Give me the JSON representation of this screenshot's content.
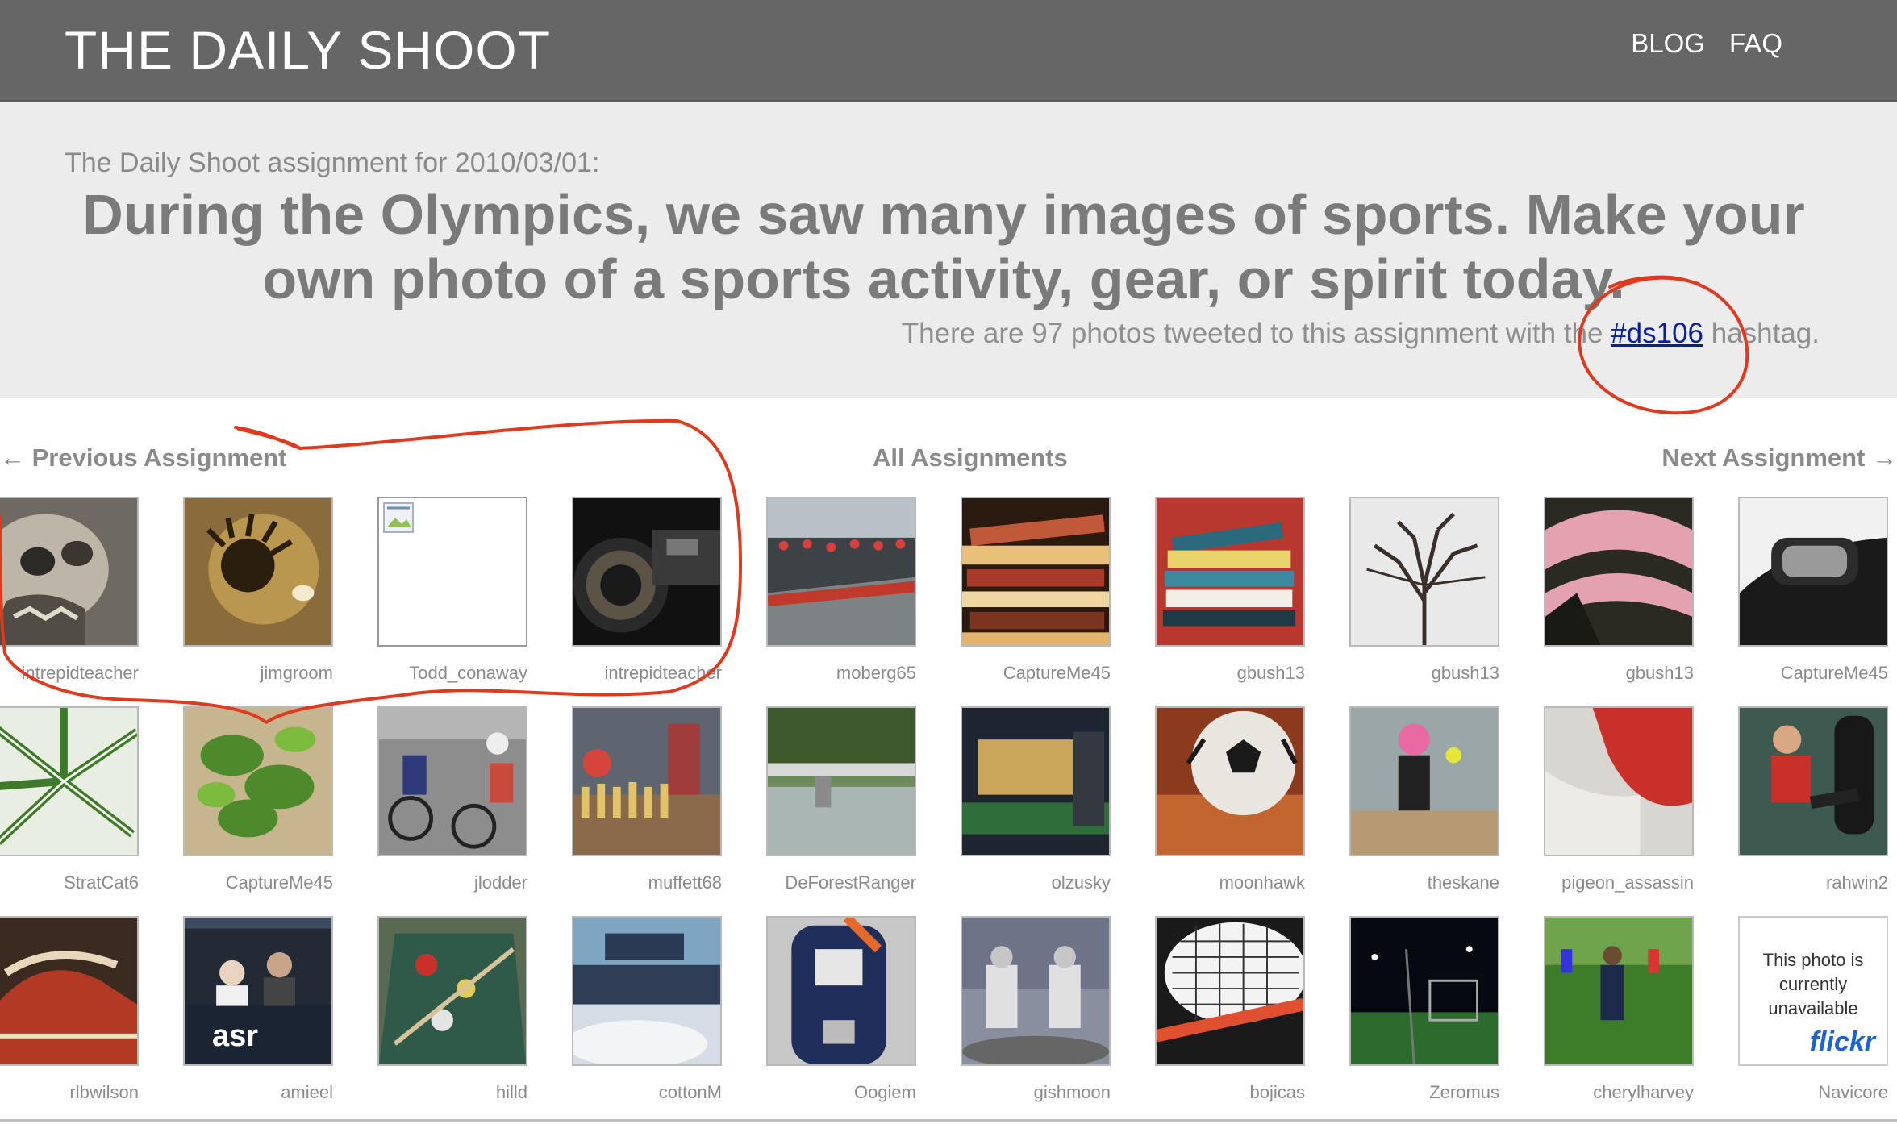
{
  "header": {
    "site_title": "THE DAILY SHOOT",
    "nav": [
      {
        "label": "BLOG"
      },
      {
        "label": "FAQ"
      }
    ]
  },
  "assignment": {
    "intro": "The Daily Shoot assignment for 2010/03/01:",
    "text": "During the Olympics, we saw many images of sports. Make your own photo of a sports activity, gear, or spirit today.",
    "count_prefix": "There are 97 photos tweeted to this assignment with the ",
    "hashtag": "#ds106",
    "count_suffix": " hashtag."
  },
  "navigation": {
    "previous": "← Previous Assignment",
    "all": "All Assignments",
    "next": "Next Assignment →"
  },
  "photos": [
    {
      "user": "intrepidteacher",
      "type": "image"
    },
    {
      "user": "jimgroom",
      "type": "image"
    },
    {
      "user": "Todd_conaway",
      "type": "broken"
    },
    {
      "user": "intrepidteacher",
      "type": "image"
    },
    {
      "user": "moberg65",
      "type": "image"
    },
    {
      "user": "CaptureMe45",
      "type": "image"
    },
    {
      "user": "gbush13",
      "type": "image"
    },
    {
      "user": "gbush13",
      "type": "image"
    },
    {
      "user": "gbush13",
      "type": "image"
    },
    {
      "user": "CaptureMe45",
      "type": "image"
    },
    {
      "user": "StratCat6",
      "type": "image"
    },
    {
      "user": "CaptureMe45",
      "type": "image"
    },
    {
      "user": "jlodder",
      "type": "image"
    },
    {
      "user": "muffett68",
      "type": "image"
    },
    {
      "user": "DeForestRanger",
      "type": "image"
    },
    {
      "user": "olzusky",
      "type": "image"
    },
    {
      "user": "moonhawk",
      "type": "image"
    },
    {
      "user": "theskane",
      "type": "image"
    },
    {
      "user": "pigeon_assassin",
      "type": "image"
    },
    {
      "user": "rahwin2",
      "type": "image"
    },
    {
      "user": "rlbwilson",
      "type": "image"
    },
    {
      "user": "amieel",
      "type": "image"
    },
    {
      "user": "hilld",
      "type": "image"
    },
    {
      "user": "cottonM",
      "type": "image"
    },
    {
      "user": "Oogiem",
      "type": "image"
    },
    {
      "user": "gishmoon",
      "type": "image"
    },
    {
      "user": "bojicas",
      "type": "image"
    },
    {
      "user": "Zeromus",
      "type": "image"
    },
    {
      "user": "cherylharvey",
      "type": "image"
    },
    {
      "user": "Navicore",
      "type": "unavailable"
    }
  ],
  "thumb_text": {
    "asr_sign": "asr",
    "unavailable_line1": "This photo is",
    "unavailable_line2": "currently",
    "unavailable_line3": "unavailable",
    "flickr_brand": "flickr"
  },
  "colors": {
    "header_bg": "#666666",
    "banner_bg": "#ececec",
    "heading_text": "#7a7a7a",
    "link": "#0a1fa0",
    "annotation": "#e03a1e"
  }
}
